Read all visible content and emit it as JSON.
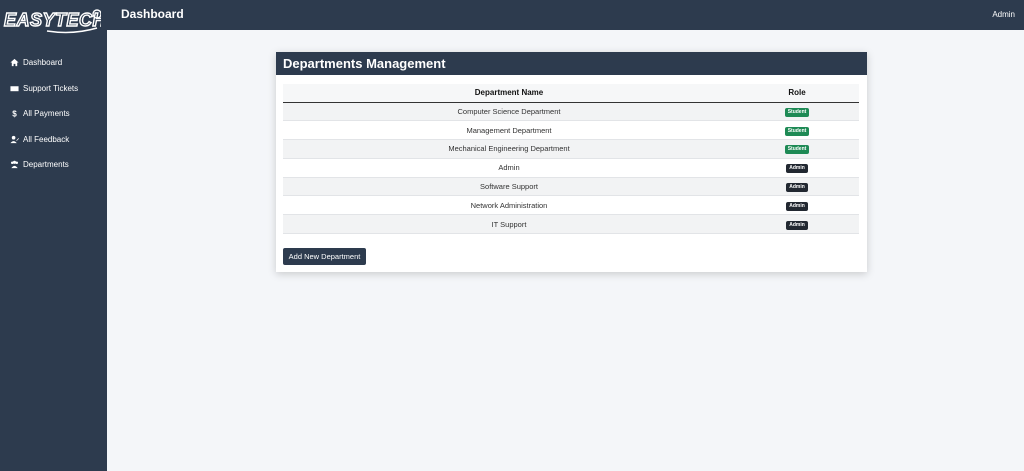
{
  "app": {
    "logo_text": "EASYTECH",
    "title": "Dashboard",
    "user": "Admin"
  },
  "sidebar": {
    "items": [
      {
        "label": "Dashboard",
        "icon": "home-icon"
      },
      {
        "label": "Support Tickets",
        "icon": "ticket-icon"
      },
      {
        "label": "All Payments",
        "icon": "dollar-icon"
      },
      {
        "label": "All Feedback",
        "icon": "user-edit-icon"
      },
      {
        "label": "Departments",
        "icon": "users-icon"
      }
    ]
  },
  "main": {
    "card_title": "Departments Management",
    "table": {
      "headers": [
        "Department Name",
        "Role"
      ],
      "rows": [
        {
          "name": "Computer Science Department",
          "role": "Student"
        },
        {
          "name": "Management Department",
          "role": "Student"
        },
        {
          "name": "Mechanical Engineering Department",
          "role": "Student"
        },
        {
          "name": "Admin",
          "role": "Admin"
        },
        {
          "name": "Software Support",
          "role": "Admin"
        },
        {
          "name": "Network Administration",
          "role": "Admin"
        },
        {
          "name": "IT Support",
          "role": "Admin"
        }
      ]
    },
    "add_button_label": "Add New Department"
  },
  "colors": {
    "primary": "#2d3b4e",
    "student_badge": "#1e8a55",
    "admin_badge": "#222831",
    "background": "#f4f6f9"
  }
}
